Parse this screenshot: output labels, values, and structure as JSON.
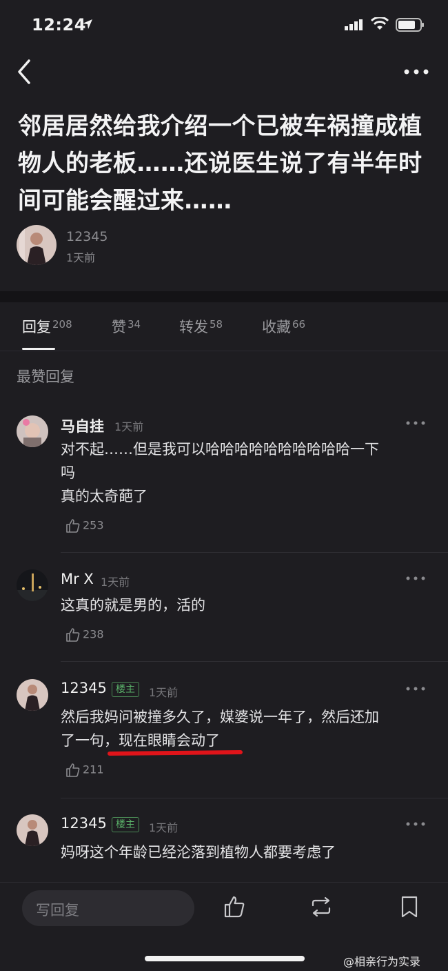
{
  "status_bar": {
    "time": "12:24"
  },
  "post": {
    "title": "邻居居然给我介绍一个已被车祸撞成植物人的老板……还说医生说了有半年时间可能会醒过来……",
    "author": "12345",
    "time": "1天前"
  },
  "tabs": [
    {
      "label": "回复",
      "count": "208"
    },
    {
      "label": "赞",
      "count": "34"
    },
    {
      "label": "转发",
      "count": "58"
    },
    {
      "label": "收藏",
      "count": "66"
    }
  ],
  "section_title": "最赞回复",
  "comments": [
    {
      "name": "马自挂",
      "badge": "",
      "time": "1天前",
      "text": "对不起……但是我可以哈哈哈哈哈哈哈哈哈哈一下吗\n真的太奇葩了",
      "likes": "253"
    },
    {
      "name": "Mr X",
      "badge": "",
      "time": "1天前",
      "text": "这真的就是男的，活的",
      "likes": "238"
    },
    {
      "name": "12345",
      "badge": "楼主",
      "time": "1天前",
      "text": "然后我妈问被撞多久了，媒婆说一年了，然后还加了一句，现在眼睛会动了",
      "likes": "211"
    },
    {
      "name": "12345",
      "badge": "楼主",
      "time": "1天前",
      "text": "妈呀这个年龄已经沦落到植物人都要考虑了",
      "likes": ""
    }
  ],
  "bottom_bar": {
    "reply_placeholder": "写回复"
  },
  "watermark": "@相亲行为实录"
}
